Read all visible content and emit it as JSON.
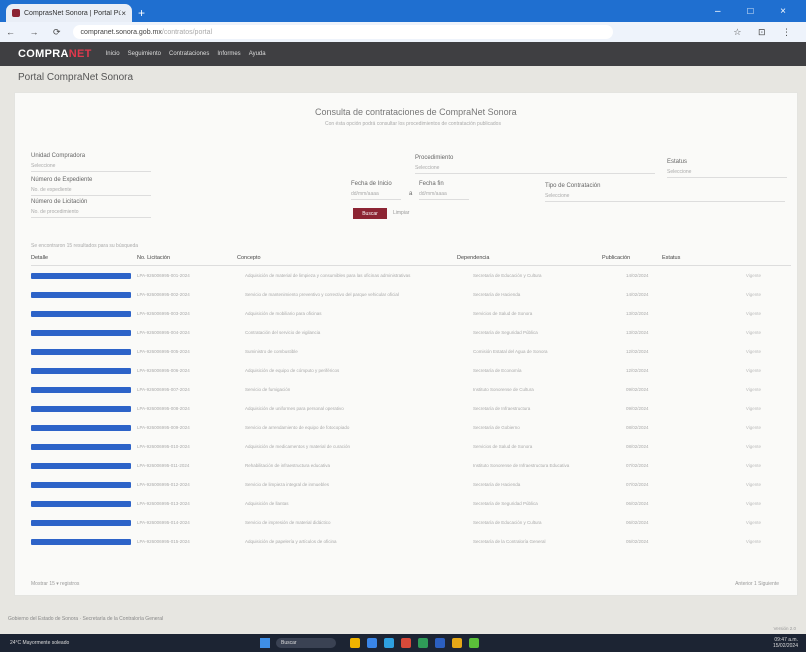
{
  "browser": {
    "tab_title": "ComprasNet Sonora | Portal Pú",
    "tab_close": "×",
    "new_tab": "+",
    "window_controls": "–  □  ×",
    "nav_buttons": "← → ⟳",
    "url": "compranet.sonora.gob.mx",
    "url_path": "/contratos/portal",
    "toolbar_icons": "☆  ⊡  ⋮"
  },
  "site": {
    "logo_main": "COMPRA",
    "logo_accent": "NET",
    "menu": [
      "Inicio",
      "Seguimiento",
      "Contrataciones",
      "Informes",
      "Ayuda"
    ],
    "page_title": "Portal CompraNet Sonora"
  },
  "form": {
    "title": "Consulta de contrataciones de CompraNet Sonora",
    "subtitle": "Con ésta opción podrá consultar los procedimientos de contratación publicados",
    "fields": [
      {
        "label": "Unidad Compradora",
        "value": "Seleccione"
      },
      {
        "label": "Procedimiento",
        "value": "Seleccione"
      },
      {
        "label": "Estatus",
        "value": "Seleccione"
      },
      {
        "label": "Número de Expediente",
        "value": "No. de expediente"
      },
      {
        "label": "Fecha de Inicio",
        "value": "dd/mm/aaaa"
      },
      {
        "label": "Fecha fin",
        "value": "dd/mm/aaaa"
      },
      {
        "label": "Tipo de Contratación",
        "value": "Seleccione"
      },
      {
        "label": "Número de Licitación",
        "value": "No. de procedimiento"
      }
    ],
    "date_separator": "a",
    "search_label": "Buscar",
    "clear_label": "Limpiar"
  },
  "results_text": "Se encontraron 15 resultados para su búsqueda",
  "table": {
    "headers": [
      "Detalle",
      "No. Licitación",
      "Concepto",
      "Dependencia",
      "Publicación",
      "Estatus"
    ],
    "rows": [
      {
        "no": "LPA-926006995-001-2024",
        "concepto": "Adquisición de material de limpieza y consumibles para las oficinas administrativas",
        "dep": "Secretaría de Educación y Cultura",
        "fecha": "14/02/2024",
        "estatus": "Vigente"
      },
      {
        "no": "LPA-926006995-002-2024",
        "concepto": "Servicio de mantenimiento preventivo y correctivo del parque vehicular oficial",
        "dep": "Secretaría de Hacienda",
        "fecha": "14/02/2024",
        "estatus": "Vigente"
      },
      {
        "no": "LPA-926006995-003-2024",
        "concepto": "Adquisición de mobiliario para oficinas",
        "dep": "Servicios de Salud de Sonora",
        "fecha": "13/02/2024",
        "estatus": "Vigente"
      },
      {
        "no": "LPA-926006995-004-2024",
        "concepto": "Contratación del servicio de vigilancia",
        "dep": "Secretaría de Seguridad Pública",
        "fecha": "13/02/2024",
        "estatus": "Vigente"
      },
      {
        "no": "LPA-926006995-005-2024",
        "concepto": "Suministro de combustible",
        "dep": "Comisión Estatal del Agua de Sonora",
        "fecha": "12/02/2024",
        "estatus": "Vigente"
      },
      {
        "no": "LPA-926006995-006-2024",
        "concepto": "Adquisición de equipo de cómputo y periféricos",
        "dep": "Secretaría de Economía",
        "fecha": "12/02/2024",
        "estatus": "Vigente"
      },
      {
        "no": "LPA-926006995-007-2024",
        "concepto": "Servicio de fumigación",
        "dep": "Instituto Sonorense de Cultura",
        "fecha": "09/02/2024",
        "estatus": "Vigente"
      },
      {
        "no": "LPA-926006995-008-2024",
        "concepto": "Adquisición de uniformes para personal operativo",
        "dep": "Secretaría de Infraestructura",
        "fecha": "09/02/2024",
        "estatus": "Vigente"
      },
      {
        "no": "LPA-926006995-009-2024",
        "concepto": "Servicio de arrendamiento de equipo de fotocopiado",
        "dep": "Secretaría de Gobierno",
        "fecha": "08/02/2024",
        "estatus": "Vigente"
      },
      {
        "no": "LPA-926006995-010-2024",
        "concepto": "Adquisición de medicamentos y material de curación",
        "dep": "Servicios de Salud de Sonora",
        "fecha": "08/02/2024",
        "estatus": "Vigente"
      },
      {
        "no": "LPA-926006995-011-2024",
        "concepto": "Rehabilitación de infraestructura educativa",
        "dep": "Instituto Sonorense de Infraestructura Educativa",
        "fecha": "07/02/2024",
        "estatus": "Vigente"
      },
      {
        "no": "LPA-926006995-012-2024",
        "concepto": "Servicio de limpieza integral de inmuebles",
        "dep": "Secretaría de Hacienda",
        "fecha": "07/02/2024",
        "estatus": "Vigente"
      },
      {
        "no": "LPA-926006995-013-2024",
        "concepto": "Adquisición de llantas",
        "dep": "Secretaría de Seguridad Pública",
        "fecha": "06/02/2024",
        "estatus": "Vigente"
      },
      {
        "no": "LPA-926006995-014-2024",
        "concepto": "Servicio de impresión de material didáctico",
        "dep": "Secretaría de Educación y Cultura",
        "fecha": "06/02/2024",
        "estatus": "Vigente"
      },
      {
        "no": "LPA-926006995-015-2024",
        "concepto": "Adquisición de papelería y artículos de oficina",
        "dep": "Secretaría de la Contraloría General",
        "fecha": "05/02/2024",
        "estatus": "Vigente"
      }
    ],
    "detail_label": "Ver detalle"
  },
  "pagination": {
    "left": "Mostrar 15 ▾ registros",
    "right": "Anterior  1  Siguiente"
  },
  "footer": {
    "text": "Gobierno del Estado de Sonora · Secretaría de la Contraloría General",
    "right": "Versión 2.0"
  },
  "taskbar": {
    "weather": "24°C Mayormente soleado",
    "search": "Buscar",
    "clock": "09:47 a.m.",
    "date": "15/02/2024"
  },
  "colors": {
    "brand": "#8c2433",
    "detail_button": "#2d63c8",
    "nav": "#3f3f42"
  }
}
